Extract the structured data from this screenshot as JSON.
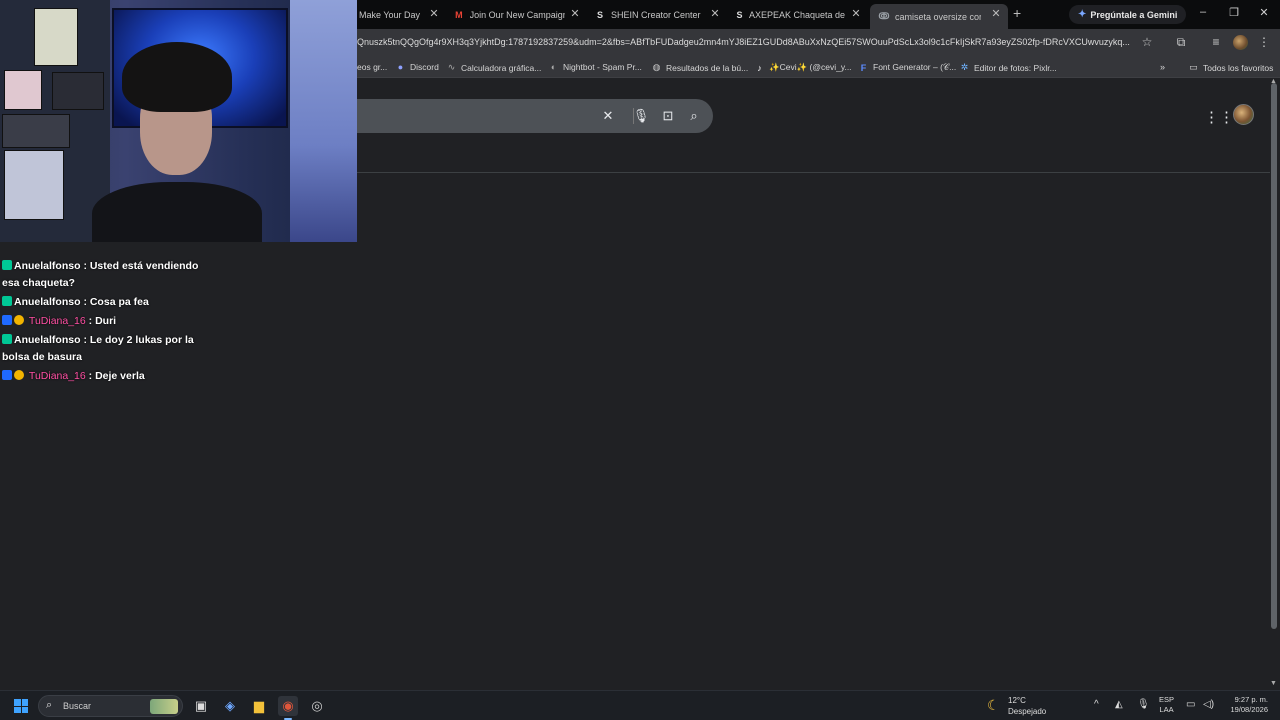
{
  "browser": {
    "tabs": [
      {
        "title": "Make Your Day",
        "favicon": "calendar-icon",
        "active": false
      },
      {
        "title": "Join Our New Campaign",
        "favicon": "gmail-icon",
        "active": false
      },
      {
        "title": "SHEIN Creator Center",
        "favicon": "shein-icon",
        "active": false
      },
      {
        "title": "AXEPEAK Chaqueta de hombre",
        "favicon": "shein-icon",
        "active": false
      },
      {
        "title": "camiseta oversize corta - Buscar con Google",
        "favicon": "google-icon",
        "active": true
      }
    ],
    "new_tab_symbol": "+",
    "gemini_label": "Pregúntale a Gemini",
    "url": "Qnuszk5tnQQgOfg4r9XH3q3YjkhtDg:1787192837259&udm=2&fbs=ABfTbFUDadgeu2mn4mYJ8iEZ1GUDd8ABuXxNzQEi57SWOuuPdScLx3ol9c1cFkIjSkR7a93eyZS02fp-fDRcVXCUwvuzykq...",
    "bookmarks": [
      {
        "label": "eos gr...",
        "icon": "folder-icon"
      },
      {
        "label": "Discord",
        "icon": "discord-icon"
      },
      {
        "label": "Calculadora gráfica...",
        "icon": "desmos-icon"
      },
      {
        "label": "Nightbot - Spam Pr...",
        "icon": "nightbot-icon"
      },
      {
        "label": "Resultados de la bú...",
        "icon": "globe-icon"
      },
      {
        "label": "✨Cevi✨ (@cevi_y...",
        "icon": "tiktok-icon"
      },
      {
        "label": "Font Generator – (𝒞...",
        "icon": "font-icon"
      },
      {
        "label": "Editor de fotos: Pixlr...",
        "icon": "pixlr-icon"
      }
    ],
    "all_bookmarks_label": "Todos los favoritos"
  },
  "chat": {
    "messages": [
      {
        "user": "Anuelalfonso",
        "text": ": Usted está vendiendo esa chaqueta?",
        "badges": [
          "mod"
        ],
        "color": "#ffffff"
      },
      {
        "user": "Anuelalfonso",
        "text": ": Cosa pa fea",
        "badges": [
          "mod"
        ],
        "color": "#ffffff"
      },
      {
        "user": "TuDiana_16",
        "text": ": Duri",
        "badges": [
          "vip",
          "sub"
        ],
        "color": "#ff4fa3"
      },
      {
        "user": "Anuelalfonso",
        "text": ": Le doy 2 lukas por la bolsa de basura",
        "badges": [
          "mod"
        ],
        "color": "#ffffff"
      },
      {
        "user": "TuDiana_16",
        "text": ": Deje verla",
        "badges": [
          "vip",
          "sub"
        ],
        "color": "#ff4fa3"
      }
    ]
  },
  "taskbar": {
    "search_label": "Buscar",
    "weather_temp": "12°C",
    "weather_condition": "Despejado",
    "lang_line1": "ESP",
    "lang_line2": "LAA",
    "time": "9:27 p. m.",
    "date": "19/08/2026"
  },
  "colors": {
    "page_bg": "#202124",
    "toolbar_bg": "#35363a",
    "tabstrip_bg": "#0b0c0d",
    "mod_badge": "#00c896",
    "vip_badge": "#1f69ff",
    "sub_badge": "#f2b400",
    "pink_username": "#ff4fa3"
  }
}
